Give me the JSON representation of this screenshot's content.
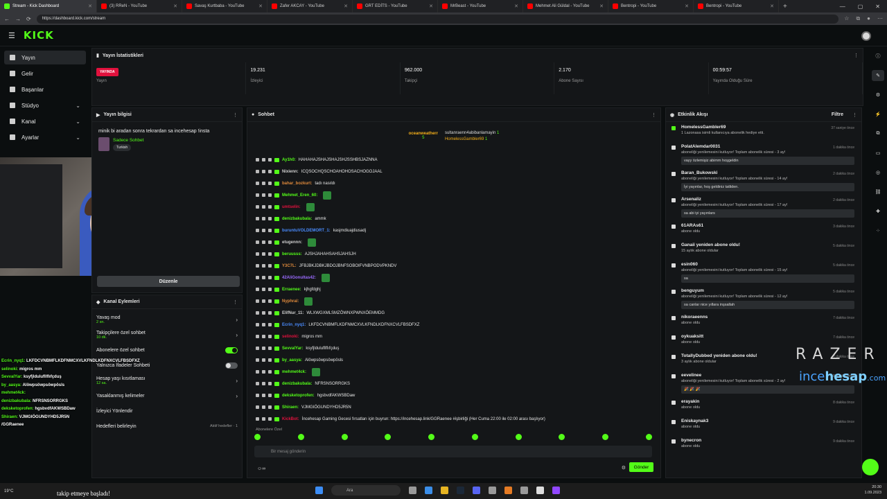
{
  "browser": {
    "tabs": [
      {
        "title": "Stream - Kick Dashboard",
        "icon": "kick-icon",
        "active": true
      },
      {
        "title": "(3) RReN - YouTube",
        "icon": "youtube-icon"
      },
      {
        "title": "Savaş Kurtbaba - YouTube",
        "icon": "youtube-icon"
      },
      {
        "title": "Zafer AKCAY - YouTube",
        "icon": "youtube-icon"
      },
      {
        "title": "GRT EDİTS - YouTube",
        "icon": "youtube-icon"
      },
      {
        "title": "MrBeast - YouTube",
        "icon": "youtube-icon"
      },
      {
        "title": "Mehmet Ali Güldal - YouTube",
        "icon": "youtube-icon"
      },
      {
        "title": "Bentropi - YouTube",
        "icon": "youtube-icon"
      },
      {
        "title": "Bentropi - YouTube",
        "icon": "youtube-icon"
      }
    ],
    "url": "https://dashboard.kick.com/stream"
  },
  "logo": "KICK",
  "sidebar": {
    "items": [
      {
        "label": "Yayın",
        "icon": "broadcast-icon",
        "active": true
      },
      {
        "label": "Gelir",
        "icon": "money-icon"
      },
      {
        "label": "Başarılar",
        "icon": "trophy-icon"
      },
      {
        "label": "Stüdyo",
        "icon": "studio-icon",
        "chevron": true
      },
      {
        "label": "Kanal",
        "icon": "channel-icon",
        "chevron": true
      },
      {
        "label": "Ayarlar",
        "icon": "gear-icon",
        "chevron": true
      }
    ]
  },
  "stats": {
    "title": "Yayın İstatistikleri",
    "live_badge": "YAYINDA",
    "items": [
      {
        "value": "",
        "label": "Yayın"
      },
      {
        "value": "19.231",
        "label": "İzleyici"
      },
      {
        "value": "962.000",
        "label": "Takipçi"
      },
      {
        "value": "2.170",
        "label": "Abone Sayısı"
      },
      {
        "value": "00:59:57",
        "label": "Yayında Olduğu Süre"
      }
    ]
  },
  "stream_info": {
    "title": "Yayın bilgisi",
    "stream_title": "minik bi aradan sonra tekrardan sa incehesap !insta",
    "category": "Sadece Sohbet",
    "tag": "Turkish",
    "edit_button": "Düzenle"
  },
  "channel_actions": {
    "title": "Kanal Eylemleri",
    "items": [
      {
        "label": "Yavaş mod",
        "sub": "2 sn.",
        "control": "arrow"
      },
      {
        "label": "Takipçilere özel sohbet",
        "sub": "10 dk.",
        "control": "arrow"
      },
      {
        "label": "Abonelere özel sohbet",
        "sub": "",
        "control": "toggle-on"
      },
      {
        "label": "Yalnızca İfadeler Sohbeti",
        "sub": "",
        "control": "toggle-off"
      },
      {
        "label": "Hesap yaşı kısıtlaması",
        "sub": "12 sa.",
        "control": "arrow"
      },
      {
        "label": "Yasaklanmış kelimeler",
        "sub": "",
        "control": "arrow"
      },
      {
        "label": "İzleyici Yönlendir",
        "sub": "",
        "control": "none"
      },
      {
        "label": "Hedefleri belirleyin",
        "sub": "",
        "control": "goal",
        "goal_text": "Aktif hedefler · 1"
      }
    ]
  },
  "overlay_chat": [
    {
      "user": "Ecrin_nyq1:",
      "text": " LKFDCVNBMFLKDFNMCXVLKFNDLKDFNXCVLFBSDFXZ"
    },
    {
      "user": "selinoki:",
      "text": " migros mm"
    },
    {
      "user": "SevvalYar:",
      "text": " ksyfjldulufllflıfçduş"
    },
    {
      "user": "by_aasya:",
      "text": " Alöwpsöwpsöwpösls"
    },
    {
      "user": "mehmet4ck:",
      "text": ""
    },
    {
      "user": "denizbakubala:",
      "text": " NFRSNSORRGKS"
    },
    {
      "user": "deksketoprofen:",
      "text": " hgsbvdfAKWSBDaw"
    },
    {
      "user": "Shiraen:",
      "text": " VJMGIÖGUNDYHD5JR5N"
    },
    {
      "user": "",
      "text": "/GGRaenee"
    }
  ],
  "chat": {
    "title": "Sohbet",
    "pinned_user1": "oceanweatherr",
    "pinned_user1_count": "5",
    "pinned_user2": "sultanraenn4abibanlamayin",
    "pinned_user2_count": "1",
    "pinned_user3": "HomelessGambler69",
    "pinned_user3_count": "1",
    "messages": [
      {
        "user": "Ay1h0:",
        "color": "#53fc18",
        "text": "HAHAHAJSHAJSHAJSHJSSHBSJAZNNA"
      },
      {
        "user": "Nixienn:",
        "color": "#cfcfcf",
        "text": "ICQSOCHQSCHOAHOHOSACHOGOJAAL"
      },
      {
        "user": "bahar_bozkurt:",
        "color": "#e08a3c",
        "text": "tadı nasıldı"
      },
      {
        "user": "Mehmet_Eren_60:",
        "color": "#53fc18",
        "text": "",
        "emote": true
      },
      {
        "user": "umtselin:",
        "color": "#e1113d",
        "text": "",
        "emote": true
      },
      {
        "user": "denizbakubala:",
        "color": "#53fc18",
        "text": "ammk"
      },
      {
        "user": "buruntuVOLDEMORT_1:",
        "color": "#4a8cff",
        "text": "kasjmdiuajdiusadj"
      },
      {
        "user": "etugennn:",
        "color": "#cfcfcf",
        "text": "",
        "emote": true
      },
      {
        "user": "beruusss:",
        "color": "#53fc18",
        "text": "AJSHJAHAHSAHSJAHSJH"
      },
      {
        "user": "Y3C7L:",
        "color": "#e08a3c",
        "text": "JFBJBKJDBKJBDOJBNFSOBOIFVNBPODVPKNDV"
      },
      {
        "user": "42AliGonultas42:",
        "color": "#9b6bff",
        "text": "",
        "emote": true
      },
      {
        "user": "Erraenee:",
        "color": "#53fc18",
        "text": "kjhgfdghj"
      },
      {
        "user": "Nyphral:",
        "color": "#e08a3c",
        "text": "",
        "emote": true
      },
      {
        "user": "ElifNur_11:",
        "color": "#cfcfcf",
        "text": "WLXWGXMLSMZÖWNXPWNXÖEMMDG"
      },
      {
        "user": "Ecrin_nyq1:",
        "color": "#4a8cff",
        "text": "LKFDCVNBMFLKDFNMCXVLKFNDLKDFNXCVLFBSDFXZ"
      },
      {
        "user": "selinoki:",
        "color": "#e1113d",
        "text": "migros mm"
      },
      {
        "user": "SevvalYar:",
        "color": "#53fc18",
        "text": "ksyfjldulufllflıfçduş"
      },
      {
        "user": "by_aasya:",
        "color": "#53fc18",
        "text": "Alöwpsöwpsöwpösls"
      },
      {
        "user": "mehmet4ck:",
        "color": "#53fc18",
        "text": "",
        "emote": true
      },
      {
        "user": "denizbakubala:",
        "color": "#53fc18",
        "text": "NFRSNSORRGKS"
      },
      {
        "user": "deksketoprofen:",
        "color": "#53fc18",
        "text": "hgsbvdfAKWSBDaw"
      },
      {
        "user": "Shiraen:",
        "color": "#53fc18",
        "text": "VJMGIÖGUNDYHD5JR5N"
      },
      {
        "user": "KickBot:",
        "color": "#e1113d",
        "text": "İncehesap Gaming Gecesi fırsatları için buyrun: https://incehesap.link/GGRaenee #işbirliği (Her Cuma 22:00 ile 02:00 arası başlıyor)"
      }
    ],
    "subscribers_only": "Abonelere Özel",
    "input_placeholder": "Bir mesaj gönderin",
    "send_button": "Gönder"
  },
  "activity": {
    "title": "Etkinlik Akışı",
    "filter": "Filtre",
    "events": [
      {
        "name": "HomelessGambler69",
        "desc": "1 Lazonasa isimli kullanıcıya abonelik hediye etti.",
        "time": "37 saniye önce",
        "icon": "gift-icon",
        "green": true
      },
      {
        "name": "PolatAlemdar0031",
        "desc": "aboneliği yenilemesini kutluyor! Toplam abonelik süresi - 3 ay!",
        "time": "1 dakika önce",
        "bubble": "vayy özlemişiz abimm hoşgeldin"
      },
      {
        "name": "Baran_Bukowski",
        "desc": "aboneliği yenilemesini kutluyor! Toplam abonelik süresi - 14 ay!",
        "time": "2 dakika önce",
        "bubble": "İyi yayınlar, hoş geldiniz tatliden."
      },
      {
        "name": "Arsenaliz",
        "desc": "aboneliği yenilemesini kutluyor! Toplam abonelik süresi - 17 ay!",
        "time": "2 dakika önce",
        "bubble": "sa abi iyi yayınlars"
      },
      {
        "name": "61ARAs61",
        "desc": "abone oldu",
        "time": "3 dakika önce"
      },
      {
        "name": "Ganaii yeniden abone oldu!",
        "desc": "15 aylık abone oldular",
        "time": "5 dakika önce"
      },
      {
        "name": "esin060",
        "desc": "aboneliği yenilemesini kutluyor! Toplam abonelik süresi - 15 ay!",
        "time": "5 dakika önce",
        "bubble": "sa"
      },
      {
        "name": "benguyum",
        "desc": "aboneliği yenilemesini kutluyor! Toplam abonelik süresi - 12 ay!",
        "time": "5 dakika önce",
        "bubble": "sa canlar nice yıllara inşsallah"
      },
      {
        "name": "nikoraeenns",
        "desc": "abone oldu",
        "time": "7 dakika önce"
      },
      {
        "name": "oykuaksitt",
        "desc": "abone oldu",
        "time": "7 dakika önce"
      },
      {
        "name": "TotallyDubbed yeniden abone oldu!",
        "desc": "3 aylık abone oldular",
        "time": "7 dakika önce"
      },
      {
        "name": "eevelinee",
        "desc": "aboneliği yenilemesini kutluyor! Toplam abonelik süresi - 2 ay!",
        "time": "8 dakika önce",
        "bubble": "🎉 🎉 🎉"
      },
      {
        "name": "erayakin",
        "desc": "abone oldu",
        "time": "8 dakika önce"
      },
      {
        "name": "Eniskaynak3",
        "desc": "abone oldu",
        "time": "9 dakika önce"
      },
      {
        "name": "bynecron",
        "desc": "abone oldu",
        "time": "9 dakika önce"
      }
    ]
  },
  "overlay": {
    "razer": "RAZER",
    "ince": "ince",
    "hesap": "hesap",
    "com": ".com",
    "follow_text": "takip etmeye başladı!",
    "weather": "19°C"
  },
  "taskbar": {
    "search": "Ara",
    "time": "20:30",
    "date": "1.09.2023"
  }
}
